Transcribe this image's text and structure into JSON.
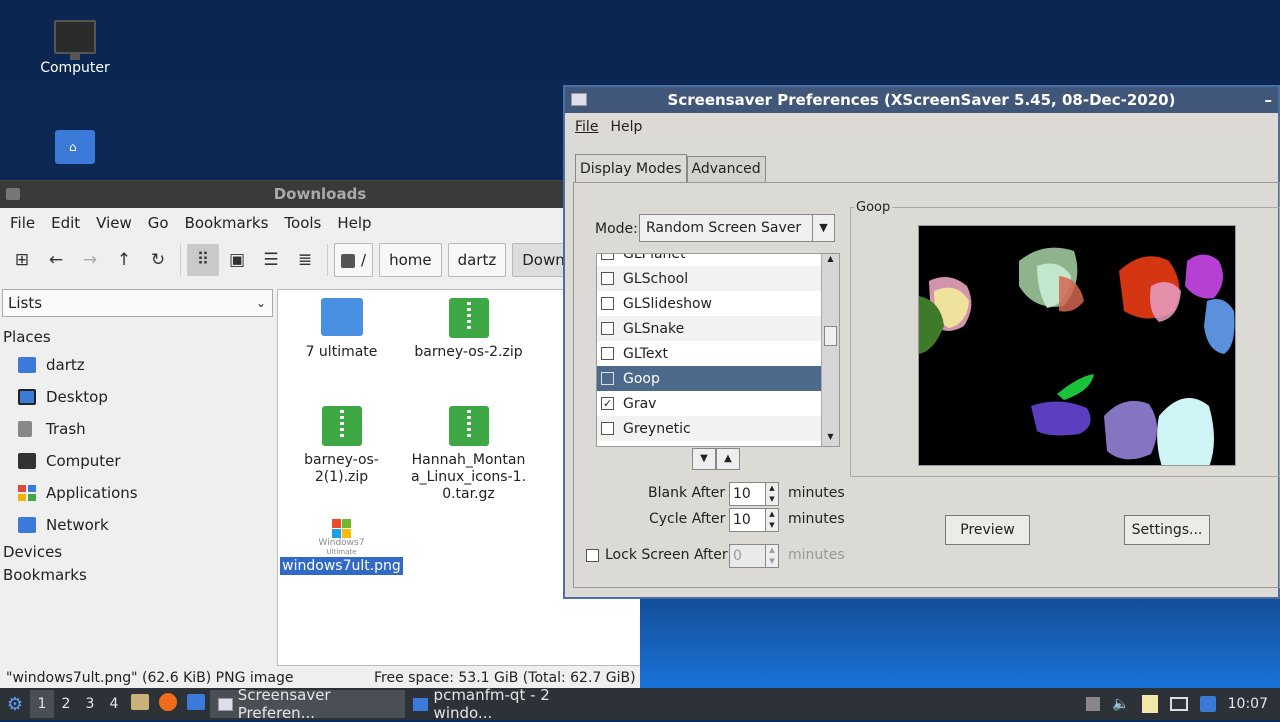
{
  "desktop": {
    "icons": [
      {
        "label": "Computer",
        "icon": "computer-icon"
      },
      {
        "label": "",
        "icon": "home-folder-icon"
      }
    ]
  },
  "file_manager": {
    "title": "Downloads",
    "menu": [
      "File",
      "Edit",
      "View",
      "Go",
      "Bookmarks",
      "Tools",
      "Help"
    ],
    "breadcrumb": [
      "/",
      "home",
      "dartz",
      "Downlo"
    ],
    "side_view_select": "Lists",
    "places_header": "Places",
    "places": [
      {
        "label": "dartz",
        "icon": "home-folder-icon",
        "color": "#3b7ad8"
      },
      {
        "label": "Desktop",
        "icon": "desktop-icon",
        "color": "#3b7ad8"
      },
      {
        "label": "Trash",
        "icon": "trash-icon",
        "color": "#888888"
      },
      {
        "label": "Computer",
        "icon": "computer-icon",
        "color": "#333333"
      },
      {
        "label": "Applications",
        "icon": "applications-icon",
        "color": "#e24a3b"
      },
      {
        "label": "Network",
        "icon": "network-icon",
        "color": "#3b7ad8"
      }
    ],
    "devices_header": "Devices",
    "bookmarks_header": "Bookmarks",
    "files": [
      {
        "name": "7 ultimate",
        "type": "folder"
      },
      {
        "name": "barney-os-2.zip",
        "type": "zip"
      },
      {
        "name": "barney-os-2(1).zip",
        "type": "zip"
      },
      {
        "name": "Hannah_Montana_Linux_icons-1.0.tar.gz",
        "type": "zip"
      },
      {
        "name": "windows7ult.png",
        "type": "image",
        "selected": true
      }
    ],
    "win7_thumb_text": "Windows7",
    "win7_thumb_sub": "Ultimate",
    "status_left": "\"windows7ult.png\" (62.6 KiB) PNG image",
    "status_right": "Free space: 53.1 GiB (Total: 62.7 GiB)"
  },
  "screensaver": {
    "title": "Screensaver Preferences  (XScreenSaver 5.45, 08-Dec-2020)",
    "minimize": "–",
    "menu": [
      "File",
      "Help"
    ],
    "tabs": [
      "Display Modes",
      "Advanced"
    ],
    "mode_label": "Mode:",
    "mode_value": "Random Screen Saver",
    "list": [
      {
        "name": "GLPlanet",
        "checked": false
      },
      {
        "name": "GLSchool",
        "checked": false
      },
      {
        "name": "GLSlideshow",
        "checked": false
      },
      {
        "name": "GLSnake",
        "checked": false
      },
      {
        "name": "GLText",
        "checked": false
      },
      {
        "name": "Goop",
        "checked": false,
        "selected": true
      },
      {
        "name": "Grav",
        "checked": true
      },
      {
        "name": "Greynetic",
        "checked": false
      }
    ],
    "blank_after_label": "Blank After",
    "blank_after_value": "10",
    "cycle_after_label": "Cycle After",
    "cycle_after_value": "10",
    "lock_label": "Lock Screen After",
    "lock_value": "0",
    "minutes": "minutes",
    "preview_group": "Goop",
    "preview_button": "Preview",
    "settings_button": "Settings..."
  },
  "taskbar": {
    "workspaces": [
      "1",
      "2",
      "3",
      "4"
    ],
    "tasks": [
      {
        "label": "Screensaver Preferen...",
        "active": true
      },
      {
        "label": "pcmanfm-qt - 2 windo...",
        "active": false
      }
    ],
    "clock": "10:07"
  }
}
